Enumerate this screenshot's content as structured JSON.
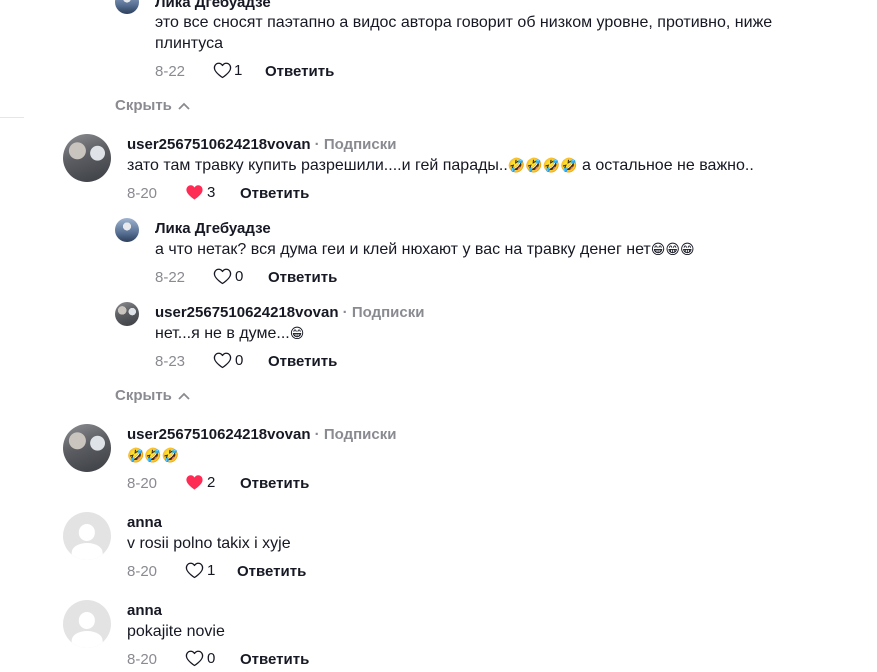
{
  "comments": [
    {
      "user": "Лика Дгебуадзе",
      "text_line1": "это все сносят паэтапно а видос автора говорит об низком уровне, противно, ниже",
      "text_line2": "плинтуса",
      "date": "8-22",
      "likes": "1",
      "liked": false,
      "reply": "Ответить"
    },
    {
      "user": "user2567510624218vovan",
      "follow": "Подписки",
      "text": "зато там травку купить разрешили....и гей парады..",
      "emoji": "🤣🤣🤣🤣",
      "text_after": " а остальное не важно..",
      "date": "8-20",
      "likes": "3",
      "liked": true,
      "reply": "Ответить"
    },
    {
      "user": "Лика Дгебуадзе",
      "text": "а что нетак? вся дума геи и клей нюхают у вас на травку денег нет",
      "emoji": "😁😁😁",
      "date": "8-22",
      "likes": "0",
      "liked": false,
      "reply": "Ответить"
    },
    {
      "user": "user2567510624218vovan",
      "follow": "Подписки",
      "text": "нет...я не в думе...",
      "emoji": "😁",
      "date": "8-23",
      "likes": "0",
      "liked": false,
      "reply": "Ответить"
    },
    {
      "user": "user2567510624218vovan",
      "follow": "Подписки",
      "emoji": "🤣🤣🤣",
      "date": "8-20",
      "likes": "2",
      "liked": true,
      "reply": "Ответить"
    },
    {
      "user": "anna",
      "text": "v rosii polno takix i xyje",
      "date": "8-20",
      "likes": "1",
      "liked": false,
      "reply": "Ответить"
    },
    {
      "user": "anna",
      "text": "pokajite novie",
      "date": "8-20",
      "likes": "0",
      "liked": false,
      "reply": "Ответить"
    }
  ],
  "hide_label": "Скрыть",
  "separator": "·",
  "icons": {
    "heart": "heart-icon",
    "chevron": "chevron-up-icon"
  },
  "colors": {
    "liked": "#fe2c55",
    "muted": "#8a8b91",
    "text": "#161823"
  }
}
